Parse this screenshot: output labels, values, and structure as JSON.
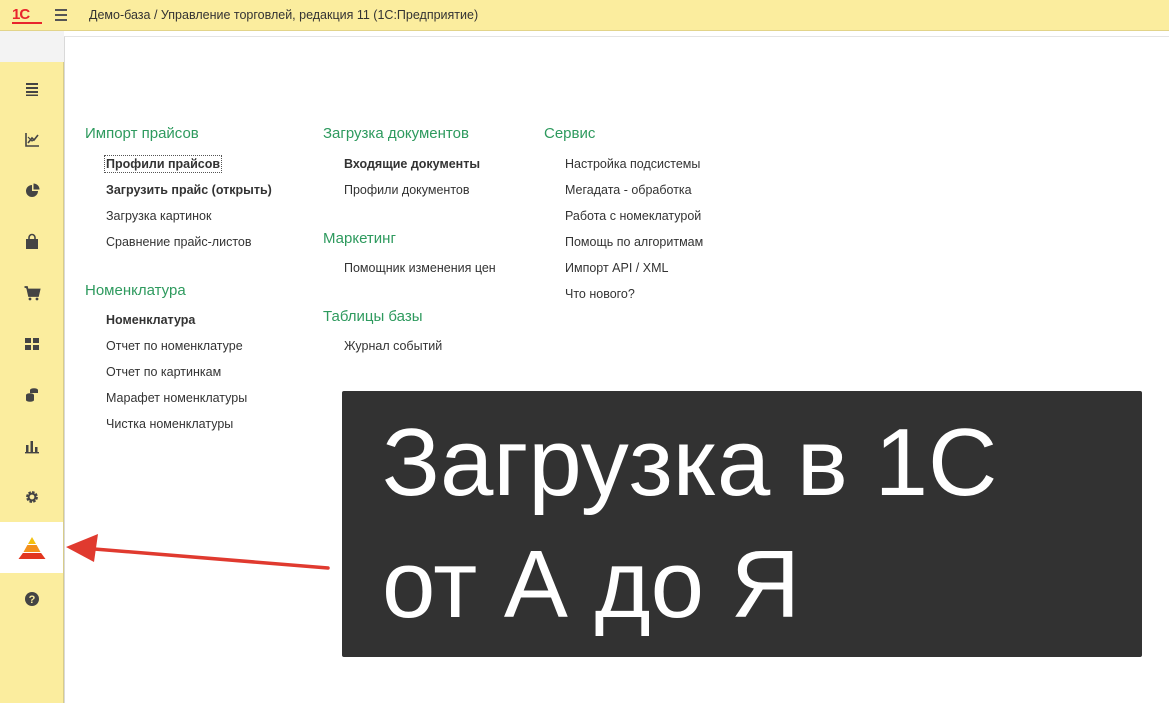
{
  "window": {
    "logo": "1С",
    "title": "Демо-база / Управление торговлей, редакция 11  (1С:Предприятие)"
  },
  "sidebar": {
    "items": [
      {
        "icon": "menu-lines-icon"
      },
      {
        "icon": "chart-arrows-icon"
      },
      {
        "icon": "pie-chart-icon"
      },
      {
        "icon": "shopping-bag-icon"
      },
      {
        "icon": "cart-icon"
      },
      {
        "icon": "warehouse-grid-icon"
      },
      {
        "icon": "coins-icon"
      },
      {
        "icon": "bar-chart-icon"
      },
      {
        "icon": "gear-icon"
      },
      {
        "icon": "pyramid-icon",
        "active": true
      },
      {
        "icon": "help-icon"
      }
    ]
  },
  "sections": {
    "col1": {
      "g1": {
        "title": "Импорт прайсов",
        "items": [
          "Профили прайсов",
          "Загрузить прайс (открыть)",
          "Загрузка картинок",
          "Сравнение прайс-листов"
        ]
      },
      "g2": {
        "title": "Номенклатура",
        "items": [
          "Номенклатура",
          "Отчет по номенклатуре",
          "Отчет по картинкам",
          "Марафет номенклатуры",
          "Чистка номенклатуры"
        ]
      }
    },
    "col2": {
      "g1": {
        "title": "Загрузка документов",
        "items": [
          "Входящие документы",
          "Профили документов"
        ]
      },
      "g2": {
        "title": "Маркетинг",
        "items": [
          "Помощник изменения цен"
        ]
      },
      "g3": {
        "title": "Таблицы базы",
        "items": [
          "Журнал событий"
        ]
      }
    },
    "col3": {
      "g1": {
        "title": "Сервис",
        "items": [
          "Настройка подсистемы",
          "Мегадата - обработка",
          "Работа с номеклатурой",
          "Помощь по алгоритмам",
          "Импорт API / XML",
          "Что нового?"
        ]
      }
    }
  },
  "overlay": {
    "line1": "Загрузка в 1С",
    "line2": "от А до Я"
  },
  "colors": {
    "titlebar": "#fbed9e",
    "group_title": "#2e9a5e",
    "overlay_bg": "#323232",
    "arrow": "#e03a2f"
  }
}
